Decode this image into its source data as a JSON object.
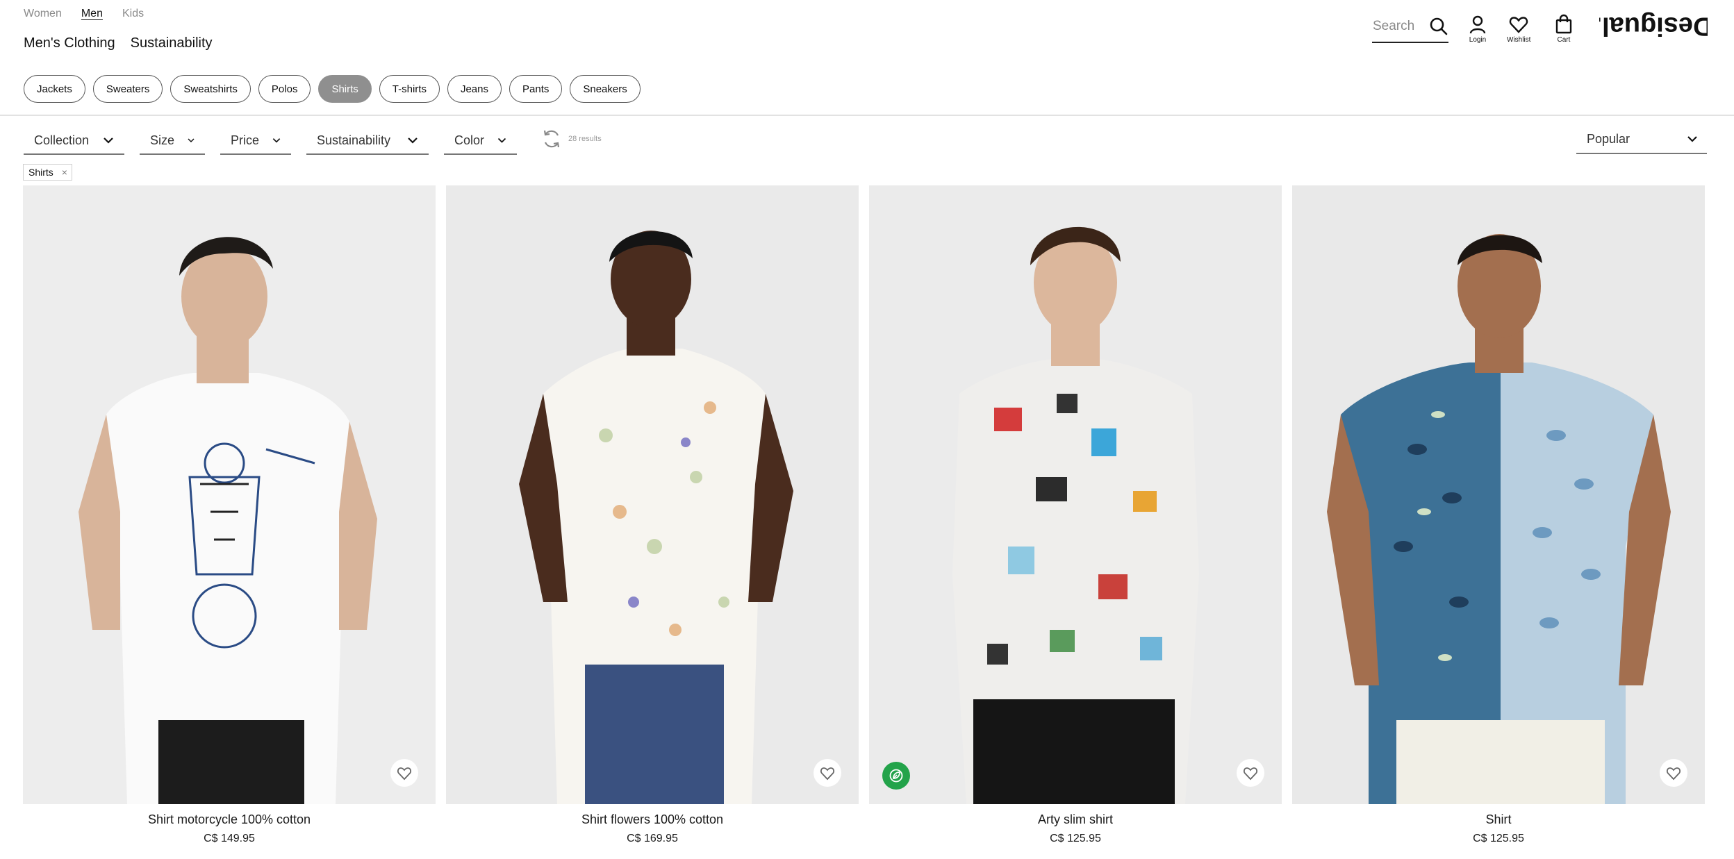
{
  "header": {
    "gender_tabs": [
      "Women",
      "Men",
      "Kids"
    ],
    "active_gender": "Men",
    "sub_nav": [
      "Men's Clothing",
      "Sustainability"
    ],
    "search_placeholder": "Search",
    "login_label": "Login",
    "wishlist_label": "Wishlist",
    "cart_label": "Cart",
    "brand": "Desigual."
  },
  "categories": {
    "items": [
      "Jackets",
      "Sweaters",
      "Sweatshirts",
      "Polos",
      "Shirts",
      "T-shirts",
      "Jeans",
      "Pants",
      "Sneakers"
    ],
    "active": "Shirts"
  },
  "filters": {
    "items": [
      "Collection",
      "Size",
      "Price",
      "Sustainability",
      "Color"
    ],
    "results": "28 results",
    "sort": "Popular",
    "active_chip": "Shirts",
    "chip_remove": "×"
  },
  "products": [
    {
      "name": "Shirt motorcycle 100% cotton",
      "price": "C$ 149.95",
      "eco": false
    },
    {
      "name": "Shirt flowers 100% cotton",
      "price": "C$ 169.95",
      "eco": false
    },
    {
      "name": "Arty slim shirt",
      "price": "C$ 125.95",
      "eco": true
    },
    {
      "name": "Shirt",
      "price": "C$ 125.95",
      "eco": false
    }
  ],
  "colors": {
    "pill_active": "#8f8f8f",
    "eco_badge": "#23a34a",
    "image_bg": "#ececec"
  },
  "icons": {
    "search": "search-icon",
    "login": "user-icon",
    "wishlist": "heart-icon",
    "cart": "bag-icon",
    "dropdown": "chevron-down-icon",
    "refresh": "refresh-icon",
    "eco": "leaf-icon"
  }
}
